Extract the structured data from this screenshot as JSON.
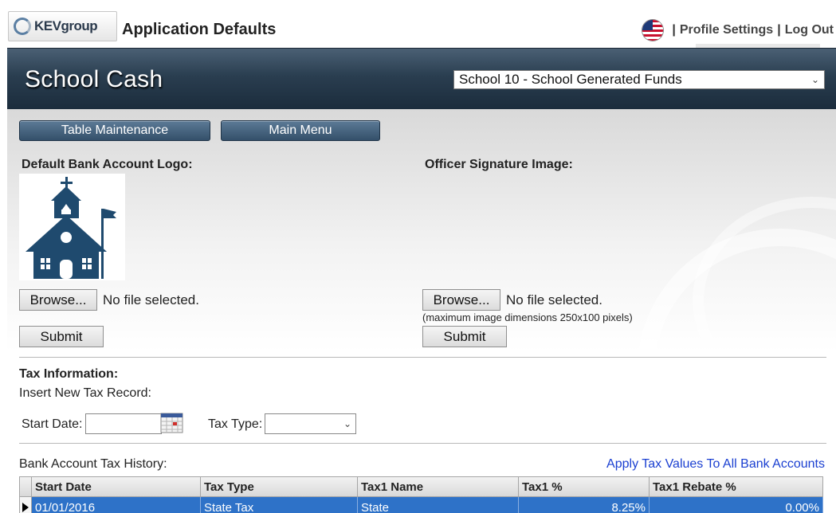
{
  "header": {
    "logo_text": "KEVgroup",
    "app_title": "Application Defaults",
    "profile_settings": "Profile Settings",
    "separator": "|",
    "log_out": "Log Out"
  },
  "banner": {
    "brand": "School Cash",
    "school_selected": "School 10 - School Generated Funds"
  },
  "nav": {
    "table_maintenance": "Table Maintenance",
    "main_menu": "Main Menu"
  },
  "logo_section": {
    "label": "Default Bank Account Logo:",
    "browse": "Browse...",
    "file_status": "No file selected.",
    "submit": "Submit"
  },
  "signature_section": {
    "label": "Officer Signature Image:",
    "browse": "Browse...",
    "file_status": "No file selected.",
    "hint": "(maximum image dimensions 250x100 pixels)",
    "submit": "Submit"
  },
  "tax": {
    "heading": "Tax Information:",
    "insert_label": "Insert New Tax Record:",
    "start_date_label": "Start Date:",
    "start_date_value": "",
    "tax_type_label": "Tax Type:",
    "tax_type_value": "",
    "history_label": "Bank Account Tax History:",
    "apply_link": "Apply Tax Values To All Bank Accounts"
  },
  "grid": {
    "columns": [
      "Start Date",
      "Tax Type",
      "Tax1 Name",
      "Tax1 %",
      "Tax1 Rebate %"
    ],
    "rows": [
      [
        "01/01/2016",
        "State Tax",
        "State",
        "8.25%",
        "0.00%"
      ]
    ]
  },
  "colors": {
    "banner": "#2a3e50",
    "selected_row": "#2e72c8",
    "link": "#1a3fd1"
  }
}
